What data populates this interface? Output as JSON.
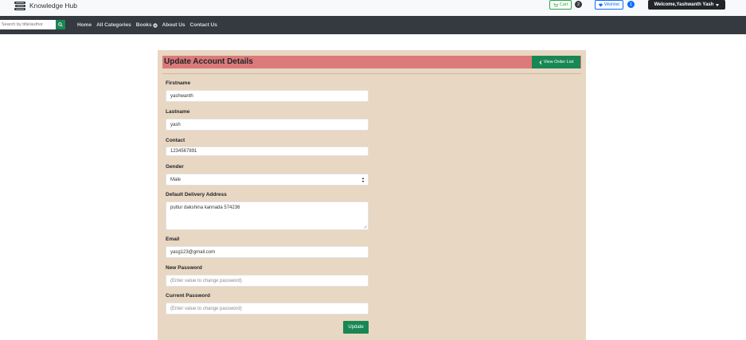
{
  "brand": {
    "name": "Knowledge Hub",
    "icon": "books-icon"
  },
  "header": {
    "cart_label": "Cart",
    "cart_count": "2",
    "wishlist_label": "Wishlist",
    "wishlist_count": "1",
    "user_menu_label": "Welcome,Yashwanth Yash"
  },
  "nav": {
    "search_placeholder": "Search by title/author",
    "links": [
      "Home",
      "All Categories",
      "Books",
      "About Us",
      "Contact Us"
    ]
  },
  "form": {
    "title": "Update Account Details",
    "view_orders_label": "View Order List",
    "firstname_label": "Firstname",
    "firstname_value": "yashwanth",
    "lastname_label": "Lastname",
    "lastname_value": "yash",
    "contact_label": "Contact",
    "contact_value": "1234567891",
    "gender_label": "Gender",
    "gender_value": "Male",
    "address_label": "Default Delivery Address",
    "address_value": "puttur dakshina kannada 574236",
    "email_label": "Email",
    "email_value": "yasg123@gmail.com",
    "new_password_label": "New Password",
    "new_password_placeholder": "(Enter value to change password)",
    "current_password_label": "Current Password",
    "current_password_placeholder": "(Enter value to change password)",
    "update_label": "Update"
  },
  "colors": {
    "navbar": "#343a40",
    "card": "#e8d7c3",
    "header": "#dc7a7a",
    "success": "#198754",
    "primary": "#0d6efd"
  }
}
